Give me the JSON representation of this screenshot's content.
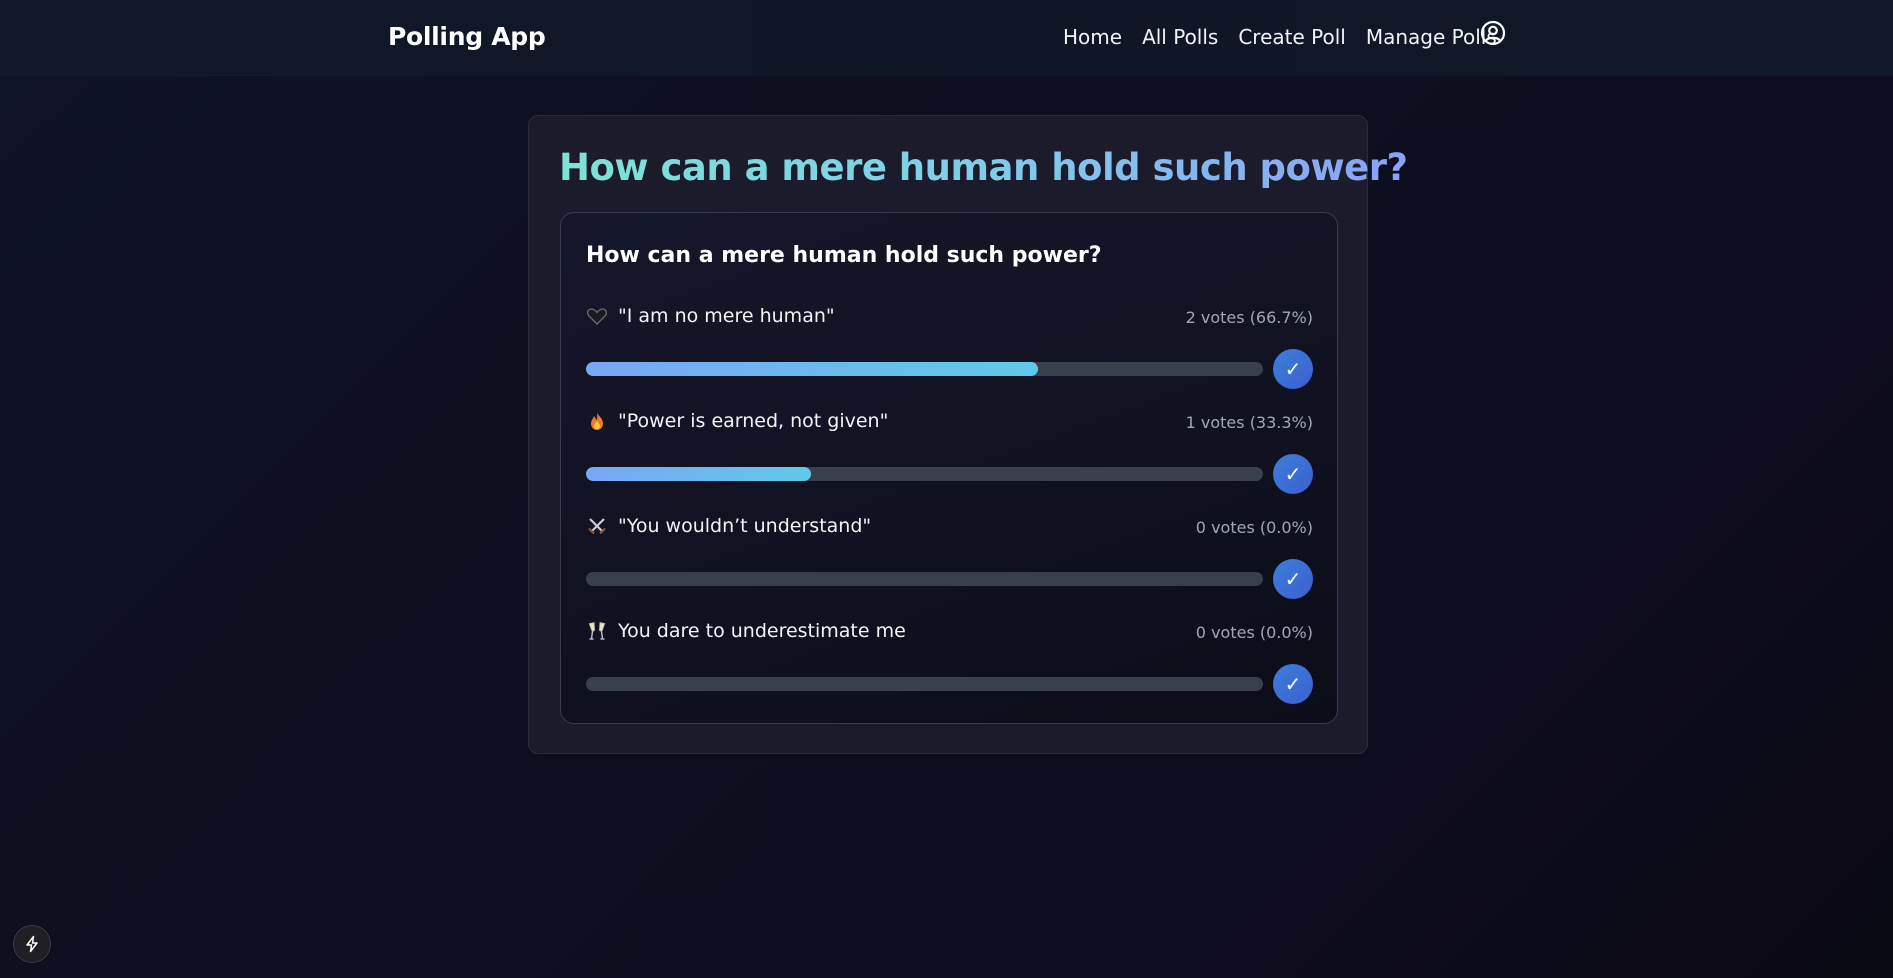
{
  "header": {
    "brand": "Polling App",
    "nav": [
      {
        "label": "Home"
      },
      {
        "label": "All Polls"
      },
      {
        "label": "Create Poll"
      },
      {
        "label": "Manage Polls"
      }
    ],
    "user_icon": "user-circle-icon"
  },
  "poll": {
    "page_title": "How can a mere human hold such power?",
    "question": "How can a mere human hold such power?",
    "options": [
      {
        "icon": "black-heart-icon",
        "label": "\"I am no mere human\"",
        "votes_text": "2 votes (66.7%)",
        "percent": 66.7,
        "action": "✓"
      },
      {
        "icon": "fire-icon",
        "label": "\"Power is earned, not given\"",
        "votes_text": "1 votes (33.3%)",
        "percent": 33.3,
        "action": "✓"
      },
      {
        "icon": "crossed-swords-icon",
        "label": "\"You wouldn’t understand\"",
        "votes_text": "0 votes (0.0%)",
        "percent": 0.0,
        "action": "✓"
      },
      {
        "icon": "champagne-glasses-icon",
        "label": "You dare to underestimate me",
        "votes_text": "0 votes (0.0%)",
        "percent": 0.0,
        "action": "✓"
      }
    ]
  },
  "colors": {
    "accent": "#3d7fd9",
    "bar_start": "#79a7f5",
    "bar_end": "#5fc9e8",
    "track": "#3a3f4c"
  },
  "footer": {
    "dev_icon": "lightning-bolt-icon"
  }
}
